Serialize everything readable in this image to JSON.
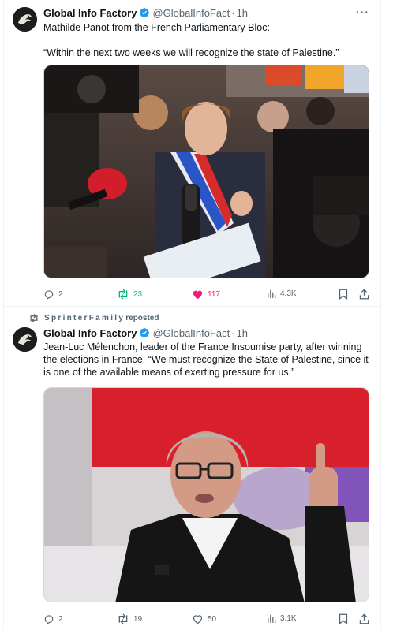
{
  "tweets": [
    {
      "author_name": "Global Info Factory",
      "handle": "@GlobalInfoFact",
      "separator": "·",
      "time": "1h",
      "more": "···",
      "text_lines": [
        "Mathilde Panot from the French Parliamentary Bloc:",
        "",
        "“Within the next two weeks we will recognize the state of Palestine.”"
      ],
      "actions": {
        "replies": "2",
        "reposts": "23",
        "likes": "117",
        "views": "4.3K"
      },
      "liked": true,
      "reposted": true
    },
    {
      "reposted_by": "SprinterFamily",
      "reposted_label": "reposted",
      "author_name": "Global Info Factory",
      "handle": "@GlobalInfoFact",
      "separator": "·",
      "time": "1h",
      "more": "···",
      "text_lines": [
        "Jean-Luc Mélenchon, leader of the France Insoumise party, after winning",
        "the elections in France: “We must recognize the State of Palestine, since it",
        "is one of the available means of exerting pressure for us.”"
      ],
      "actions": {
        "replies": "2",
        "reposts": "19",
        "likes": "50",
        "views": "3.1K"
      },
      "liked": false,
      "reposted": false
    }
  ],
  "icons": {
    "verified": "verified-badge-icon",
    "reply": "reply-icon",
    "repost": "repost-icon",
    "like": "heart-icon",
    "views": "views-icon",
    "bookmark": "bookmark-icon",
    "share": "share-icon",
    "more": "more-icon"
  },
  "colors": {
    "verified": "#1d9bf0",
    "repost_active": "#00ba7c",
    "like_active": "#f91880",
    "secondary_text": "#536471",
    "border": "#eff3f4"
  }
}
